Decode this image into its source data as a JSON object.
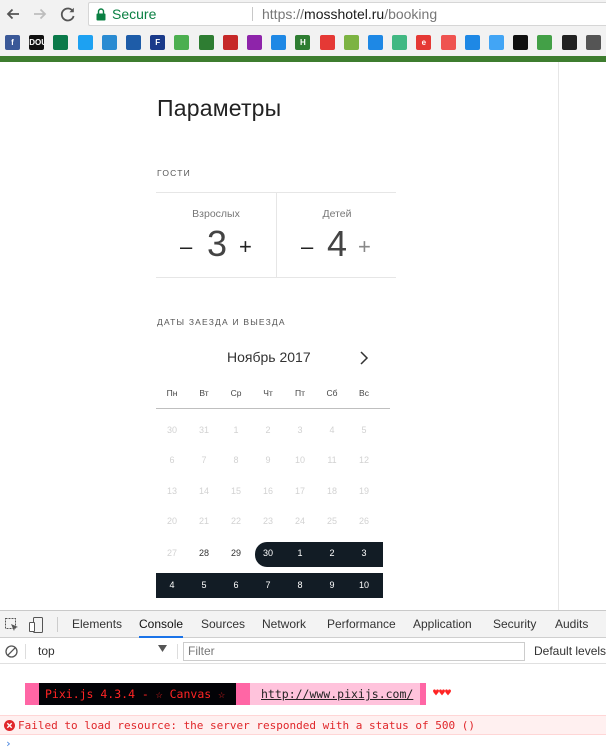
{
  "browser": {
    "secure_label": "Secure",
    "url_scheme": "https://",
    "url_host": "mosshotel.ru",
    "url_path": "/booking"
  },
  "bookmarks": [
    {
      "icon": "facebook-icon",
      "label": "f",
      "color": "#3b5998"
    },
    {
      "icon": "dou-icon",
      "label": "DOU",
      "color": "#111111"
    },
    {
      "icon": "bars-icon",
      "label": "",
      "color": "#0b7a4a"
    },
    {
      "icon": "twitter-icon",
      "label": "",
      "color": "#1da1f2"
    },
    {
      "icon": "umbrella-icon",
      "label": "",
      "color": "#2a8bd2"
    },
    {
      "icon": "slash-icon",
      "label": "",
      "color": "#1e5ca8"
    },
    {
      "icon": "f-icon",
      "label": "F",
      "color": "#1a3a8a"
    },
    {
      "icon": "square-icon",
      "label": "",
      "color": "#4caf50"
    },
    {
      "icon": "doc-icon",
      "label": "",
      "color": "#2e7d32"
    },
    {
      "icon": "badge-icon",
      "label": "",
      "color": "#c62828"
    },
    {
      "icon": "star-icon",
      "label": "",
      "color": "#8e24aa"
    },
    {
      "icon": "butterfly-icon",
      "label": "",
      "color": "#1e88e5"
    },
    {
      "icon": "h-icon",
      "label": "H",
      "color": "#2e7d32"
    },
    {
      "icon": "youtube-icon",
      "label": "",
      "color": "#e53935"
    },
    {
      "icon": "eye-icon",
      "label": "",
      "color": "#7cb342"
    },
    {
      "icon": "pocket-icon",
      "label": "",
      "color": "#1e88e5"
    },
    {
      "icon": "vue-icon",
      "label": "",
      "color": "#41b883"
    },
    {
      "icon": "e-icon",
      "label": "e",
      "color": "#e53935"
    },
    {
      "icon": "tab-icon",
      "label": "",
      "color": "#ef5350"
    },
    {
      "icon": "chart-icon",
      "label": "",
      "color": "#1e88e5"
    },
    {
      "icon": "diamond-icon",
      "label": "",
      "color": "#42a5f5"
    },
    {
      "icon": "target-icon",
      "label": "",
      "color": "#111111"
    },
    {
      "icon": "bolt-icon",
      "label": "",
      "color": "#43a047"
    },
    {
      "icon": "github-icon",
      "label": "",
      "color": "#222222"
    },
    {
      "icon": "codepen-icon",
      "label": "",
      "color": "#555555"
    }
  ],
  "page": {
    "title": "Параметры",
    "guests_title": "ГОСТИ",
    "adults_label": "Взрослых",
    "adults_value": "3",
    "children_label": "Детей",
    "children_value": "4",
    "minus": "–",
    "plus": "+",
    "dates_title": "ДАТЫ ЗАЕЗДА И ВЫЕЗДА",
    "month": "Ноябрь 2017",
    "weekdays": [
      "Пн",
      "Вт",
      "Ср",
      "Чт",
      "Пт",
      "Сб",
      "Вс"
    ],
    "weeks": [
      [
        {
          "d": "30",
          "s": "past"
        },
        {
          "d": "31",
          "s": "past"
        },
        {
          "d": "1",
          "s": "past"
        },
        {
          "d": "2",
          "s": "past"
        },
        {
          "d": "3",
          "s": "past"
        },
        {
          "d": "4",
          "s": "past"
        },
        {
          "d": "5",
          "s": "past"
        }
      ],
      [
        {
          "d": "6",
          "s": "past"
        },
        {
          "d": "7",
          "s": "past"
        },
        {
          "d": "8",
          "s": "past"
        },
        {
          "d": "9",
          "s": "past"
        },
        {
          "d": "10",
          "s": "past"
        },
        {
          "d": "11",
          "s": "past"
        },
        {
          "d": "12",
          "s": "past"
        }
      ],
      [
        {
          "d": "13",
          "s": "past"
        },
        {
          "d": "14",
          "s": "past"
        },
        {
          "d": "15",
          "s": "past"
        },
        {
          "d": "16",
          "s": "past"
        },
        {
          "d": "17",
          "s": "past"
        },
        {
          "d": "18",
          "s": "past"
        },
        {
          "d": "19",
          "s": "past"
        }
      ],
      [
        {
          "d": "20",
          "s": "past"
        },
        {
          "d": "21",
          "s": "past"
        },
        {
          "d": "22",
          "s": "past"
        },
        {
          "d": "23",
          "s": "past"
        },
        {
          "d": "24",
          "s": "past"
        },
        {
          "d": "25",
          "s": "past"
        },
        {
          "d": "26",
          "s": "past"
        }
      ],
      [
        {
          "d": "27",
          "s": "past"
        },
        {
          "d": "28",
          "s": "cur"
        },
        {
          "d": "29",
          "s": "cur"
        },
        {
          "d": "30",
          "s": "sel"
        },
        {
          "d": "1",
          "s": "sel"
        },
        {
          "d": "2",
          "s": "sel"
        },
        {
          "d": "3",
          "s": "sel"
        }
      ],
      [
        {
          "d": "4",
          "s": "sel"
        },
        {
          "d": "5",
          "s": "sel"
        },
        {
          "d": "6",
          "s": "sel"
        },
        {
          "d": "7",
          "s": "sel"
        },
        {
          "d": "8",
          "s": "sel"
        },
        {
          "d": "9",
          "s": "sel"
        },
        {
          "d": "10",
          "s": "sel"
        }
      ]
    ]
  },
  "devtools": {
    "tabs": [
      "Elements",
      "Console",
      "Sources",
      "Network",
      "Performance",
      "Application",
      "Security",
      "Audits"
    ],
    "active_tab": "Console",
    "context": "top",
    "filter_placeholder": "Filter",
    "levels": "Default levels",
    "pixi_text": "Pixi.js 4.3.4 - ☆ Canvas ☆",
    "pixi_link": "http://www.pixijs.com/",
    "pixi_hearts": "♥♥♥",
    "error_text": "Failed to load resource: the server responded with a status of 500 ()"
  }
}
